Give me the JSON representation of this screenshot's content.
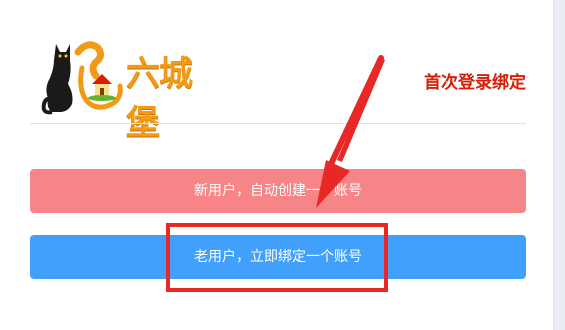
{
  "logo": {
    "text": "六城堡"
  },
  "header": {
    "title": "首次登录绑定"
  },
  "buttons": {
    "new_user": "新用户，自动创建一个账号",
    "existing_user": "老用户，立即绑定一个账号"
  },
  "colors": {
    "title": "#d81e06",
    "new_user_button": "#f78587",
    "existing_user_button": "#41a0fc",
    "annotation": "#e82727",
    "logo_text": "#f39a14"
  }
}
